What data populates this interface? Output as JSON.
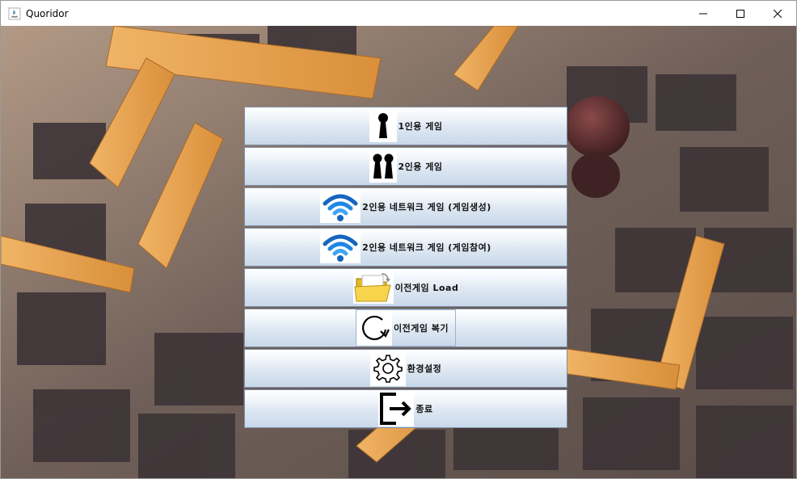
{
  "window": {
    "title": "Quoridor",
    "icon": "java-app-icon"
  },
  "controls": {
    "minimize": "minimize-icon",
    "maximize": "maximize-icon",
    "close": "close-icon"
  },
  "menu": {
    "items": [
      {
        "label": "1인용 게임",
        "icon": "single-pawn-icon"
      },
      {
        "label": "2인용 게임",
        "icon": "two-pawns-icon"
      },
      {
        "label": "2인용 네트워크 게임 (게임생성)",
        "icon": "wifi-icon"
      },
      {
        "label": "2인용 네트워크 게임 (게임참여)",
        "icon": "wifi-icon"
      },
      {
        "label": "이전게임 Load",
        "icon": "folder-icon"
      },
      {
        "label": "이전게임 복기",
        "icon": "replay-icon"
      },
      {
        "label": "환경설정",
        "icon": "gear-icon"
      },
      {
        "label": "종료",
        "icon": "exit-icon"
      }
    ]
  }
}
